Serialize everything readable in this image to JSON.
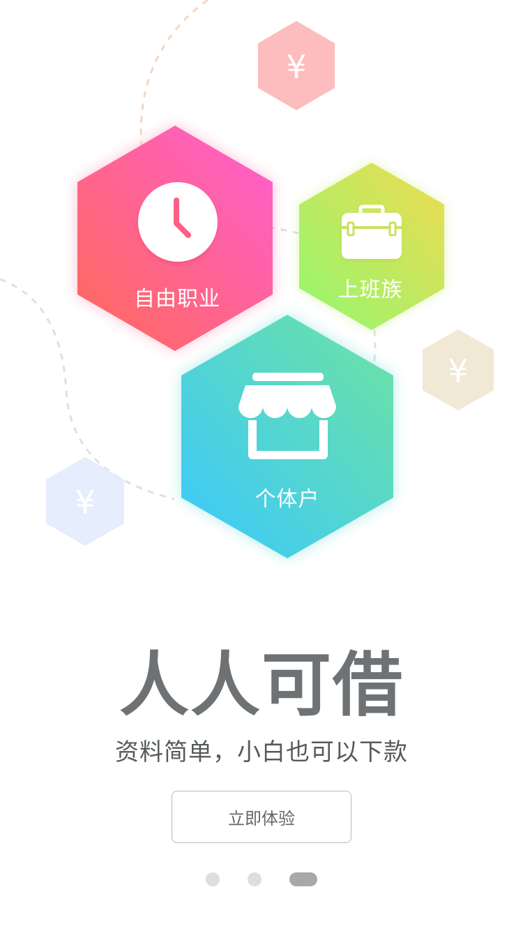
{
  "hexagons": {
    "freelance": {
      "label": "自由职业",
      "icon": "clock-icon"
    },
    "office_worker": {
      "label": "上班族",
      "icon": "briefcase-icon"
    },
    "merchant": {
      "label": "个体户",
      "icon": "storefront-icon"
    }
  },
  "decorations": {
    "yen_symbol": "¥",
    "colors": {
      "yen_top": "#fdbcbd",
      "yen_right": "#f2e8d6",
      "yen_left": "#e6edfd"
    }
  },
  "colors": {
    "freelance_gradient": [
      "#ff5e62",
      "#ff62c8"
    ],
    "office_gradient": [
      "#a3f36b",
      "#e8dc52"
    ],
    "merchant_gradient": [
      "#40c9ff",
      "#6ae2a4"
    ]
  },
  "hero": {
    "title": "人人可借",
    "subtitle": "资料简单，小白也可以下款"
  },
  "cta": {
    "label": "立即体验"
  },
  "pager": {
    "total": 3,
    "active_index": 2
  }
}
